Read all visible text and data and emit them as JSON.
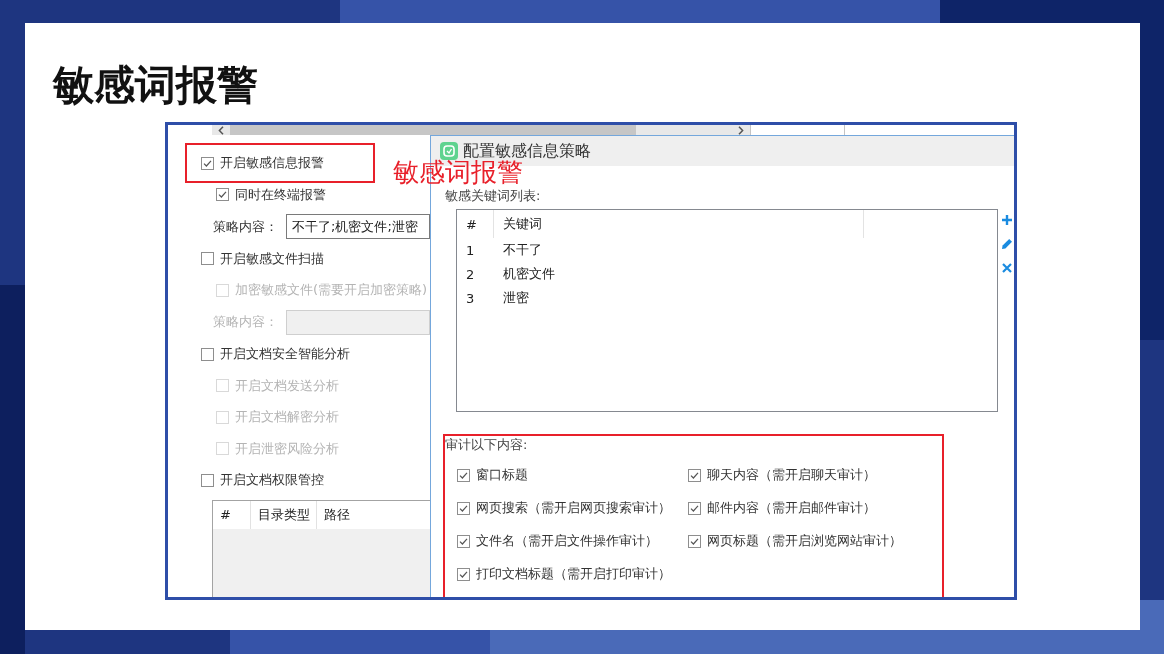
{
  "slide": {
    "title": "敏感词报警"
  },
  "annotation": {
    "text": "敏感词报警"
  },
  "settings_panel": {
    "options": [
      {
        "label": "开启敏感信息报警",
        "checked": true,
        "highlighted": true,
        "children": [
          {
            "kind": "checkbox",
            "label": "同时在终端报警",
            "checked": true,
            "disabled": false
          },
          {
            "kind": "field",
            "label": "策略内容：",
            "value": "不干了;机密文件;泄密",
            "disabled": false
          }
        ]
      },
      {
        "label": "开启敏感文件扫描",
        "checked": false,
        "highlighted": false,
        "children": [
          {
            "kind": "checkbox",
            "label": "加密敏感文件(需要开启加密策略)",
            "checked": false,
            "disabled": true
          },
          {
            "kind": "field",
            "label": "策略内容：",
            "disabled": true
          }
        ]
      },
      {
        "label": "开启文档安全智能分析",
        "checked": false,
        "highlighted": false,
        "children": [
          {
            "kind": "checkbox",
            "label": "开启文档发送分析",
            "checked": false,
            "disabled": true
          },
          {
            "kind": "checkbox",
            "label": "开启文档解密分析",
            "checked": false,
            "disabled": true
          },
          {
            "kind": "checkbox",
            "label": "开启泄密风险分析",
            "checked": false,
            "disabled": true
          }
        ]
      },
      {
        "label": "开启文档权限管控",
        "checked": false,
        "highlighted": false,
        "children": [
          {
            "kind": "table",
            "columns": [
              "#",
              "目录类型",
              "路径"
            ]
          }
        ]
      }
    ]
  },
  "dialog": {
    "title": "配置敏感信息策略",
    "keyword_list": {
      "label": "敏感关键词列表:",
      "columns": [
        "#",
        "关键词"
      ],
      "rows": [
        [
          "1",
          "不干了"
        ],
        [
          "2",
          "机密文件"
        ],
        [
          "3",
          "泄密"
        ]
      ]
    },
    "audit": {
      "label": "审计以下内容:",
      "highlighted": true,
      "items": [
        {
          "label": "窗口标题",
          "checked": true
        },
        {
          "label": "聊天内容（需开启聊天审计）",
          "checked": true
        },
        {
          "label": "网页搜索（需开启网页搜索审计）",
          "checked": true
        },
        {
          "label": "邮件内容（需开启邮件审计）",
          "checked": true
        },
        {
          "label": "文件名（需开启文件操作审计）",
          "checked": true
        },
        {
          "label": "网页标题（需开启浏览网站审计）",
          "checked": true
        },
        {
          "label": "打印文档标题（需开启打印审计）",
          "checked": true
        }
      ]
    }
  }
}
